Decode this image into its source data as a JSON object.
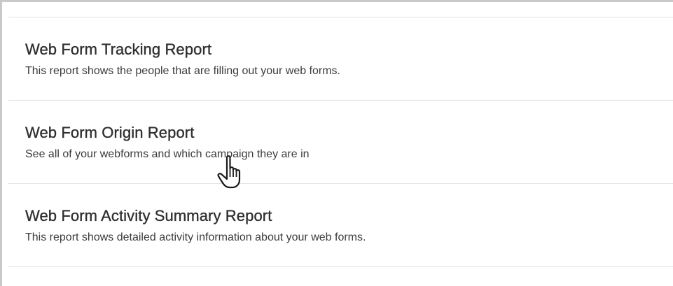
{
  "reports": [
    {
      "title": "Web Form Tracking Report",
      "description": "This report shows the people that are filling out your web forms."
    },
    {
      "title": "Web Form Origin Report",
      "description": "See all of your webforms and which campaign they are in"
    },
    {
      "title": "Web Form Activity Summary Report",
      "description": "This report shows detailed activity information about your web forms."
    }
  ],
  "cursor": {
    "icon": "hand-pointer-icon"
  },
  "colors": {
    "title": "#2f2f2f",
    "description": "#3c3c3c",
    "divider": "#e4e4e4",
    "frame_border": "#c9c9c9"
  }
}
